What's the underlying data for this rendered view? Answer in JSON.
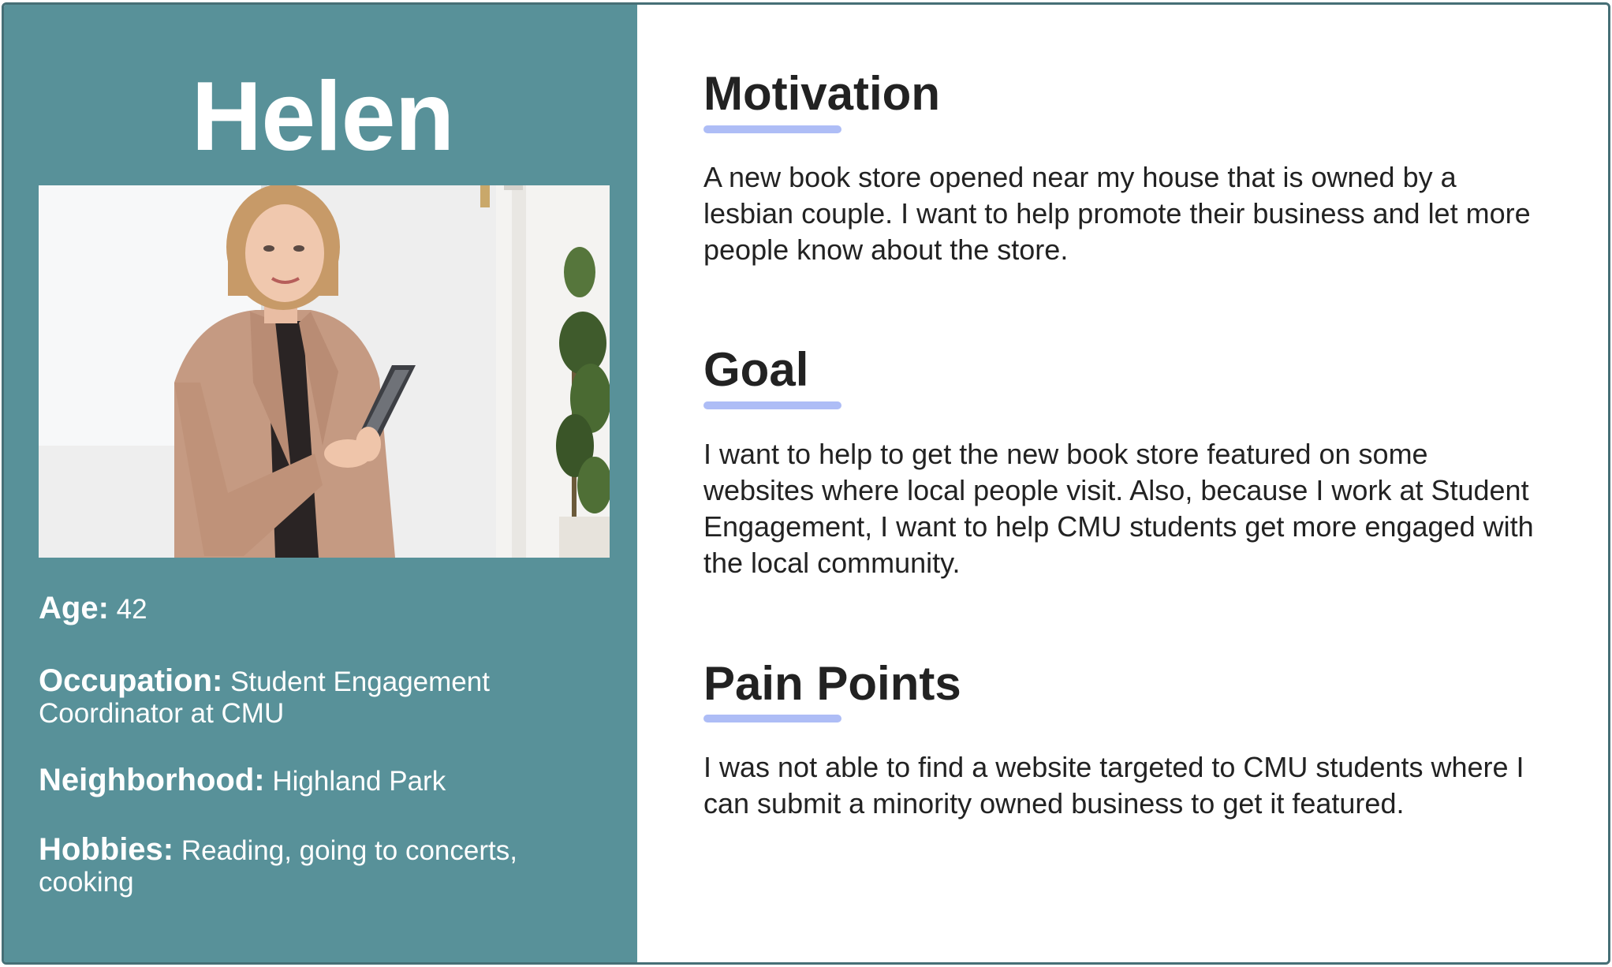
{
  "persona": {
    "name": "Helen",
    "photo_alt": "Portrait of a woman in a tan blazer holding a tablet",
    "facts": [
      {
        "label": "Age:",
        "value": "42"
      },
      {
        "label": "Occupation:",
        "value": "Student Engagement Coordinator at CMU"
      },
      {
        "label": "Neighborhood:",
        "value": "Highland Park"
      },
      {
        "label": "Hobbies:",
        "value": "Reading, going to concerts, cooking"
      }
    ]
  },
  "sections": [
    {
      "title": "Motivation",
      "body": "A new book store opened near my house that is owned by a lesbian couple. I want to help promote their business and let more people know about the store."
    },
    {
      "title": "Goal",
      "body": "I want to help to get the new book store featured on some websites where local people visit. Also, because I work at Student Engagement, I want to help CMU students get more engaged with the local community."
    },
    {
      "title": "Pain Points",
      "body": "I was not able to find a website targeted to CMU students where I can submit a minority owned business to get it featured."
    }
  ],
  "colors": {
    "panel": "#589199",
    "border": "#466f76",
    "underline": "#aebdf6",
    "text": "#222222"
  }
}
